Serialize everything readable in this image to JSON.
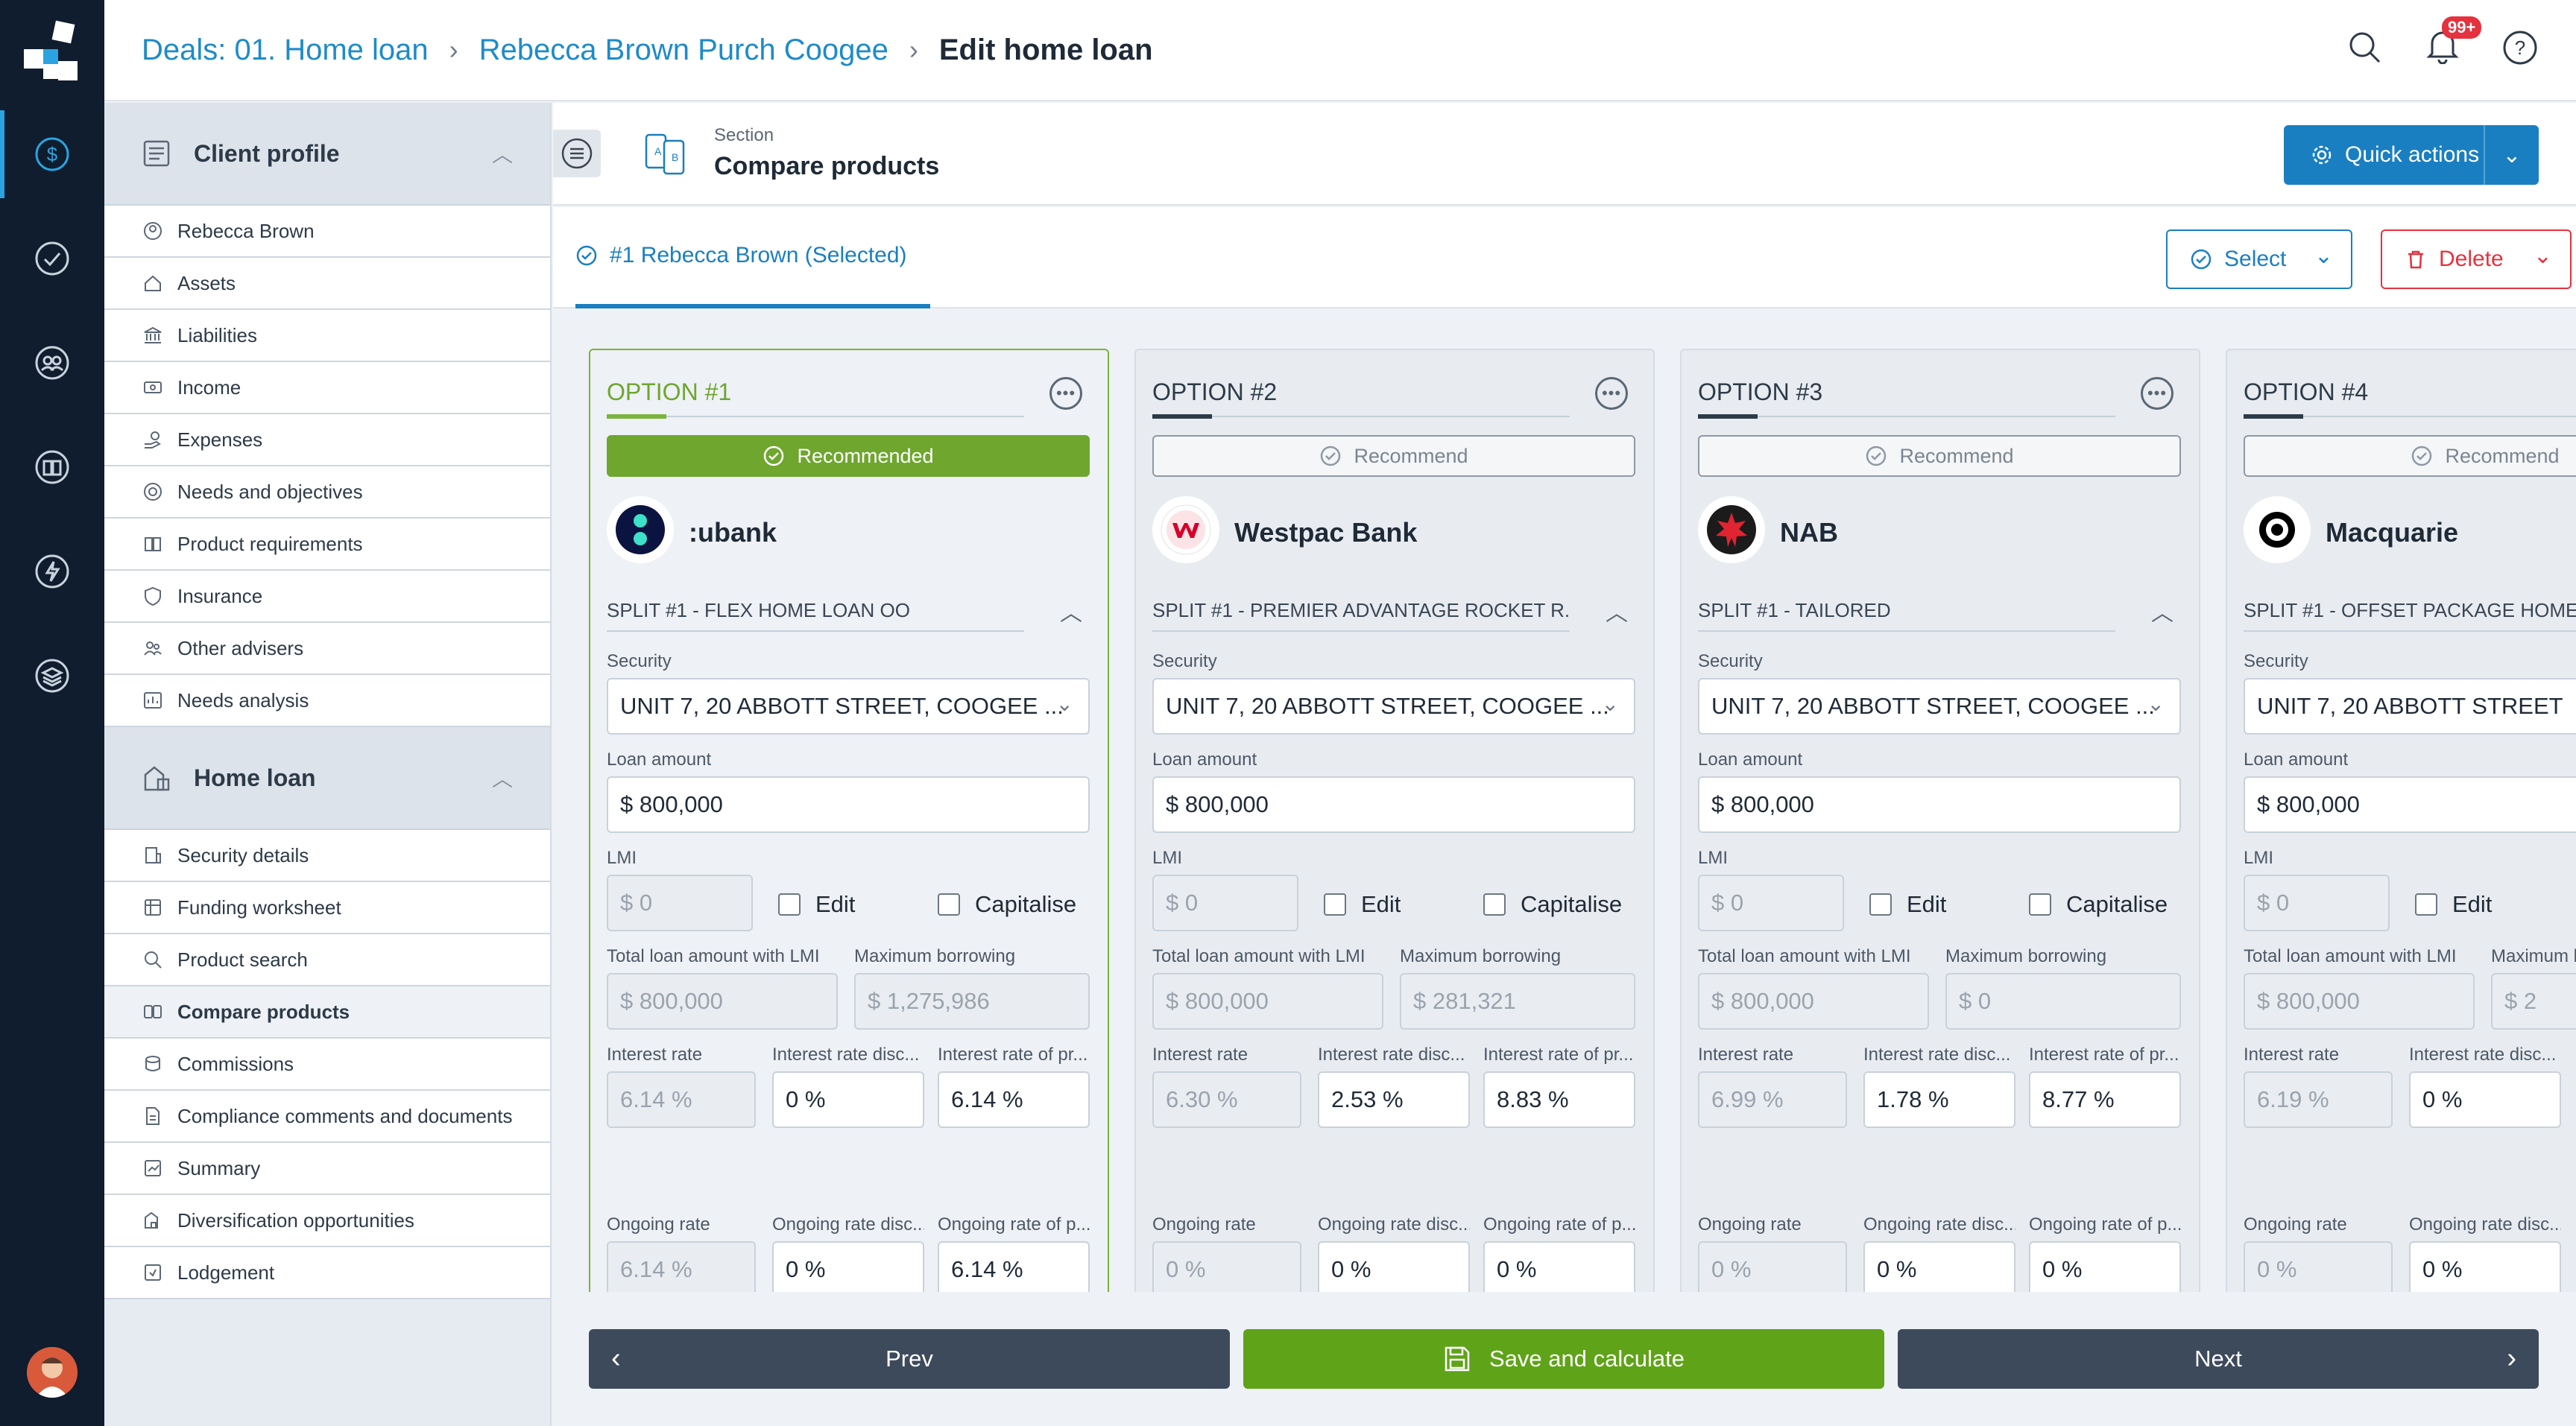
{
  "breadcrumb": {
    "crumb1": "Deals: 01. Home loan",
    "crumb2": "Rebecca Brown Purch Coogee",
    "current": "Edit home loan"
  },
  "notifications": {
    "badge": "99+"
  },
  "sidebar": {
    "client_profile": {
      "title": "Client profile",
      "items": [
        "Rebecca Brown",
        "Assets",
        "Liabilities",
        "Income",
        "Expenses",
        "Needs and objectives",
        "Product requirements",
        "Insurance",
        "Other advisers",
        "Needs analysis"
      ]
    },
    "home_loan": {
      "title": "Home loan",
      "items": [
        "Security details",
        "Funding worksheet",
        "Product search",
        "Compare products",
        "Commissions",
        "Compliance comments and documents",
        "Summary",
        "Diversification opportunities",
        "Lodgement"
      ]
    }
  },
  "section": {
    "small": "Section",
    "title": "Compare products",
    "quick_actions": "Quick actions"
  },
  "tabbar": {
    "tab": "#1 Rebecca Brown (Selected)",
    "select": "Select",
    "delete": "Delete"
  },
  "labels": {
    "security": "Security",
    "loan_amount": "Loan amount",
    "lmi": "LMI",
    "edit": "Edit",
    "capitalise": "Capitalise",
    "total_loan": "Total loan amount with LMI",
    "max_borrowing": "Maximum borrowing",
    "interest_rate": "Interest rate",
    "interest_disc": "Interest rate disc...",
    "interest_prod": "Interest rate of pr...",
    "ongoing_rate": "Ongoing rate",
    "ongoing_disc": "Ongoing rate disc...",
    "ongoing_prod": "Ongoing rate of p..."
  },
  "options": [
    {
      "title": "OPTION #1",
      "recommend": "Recommended",
      "bank": ":ubank",
      "split": "SPLIT #1 - FLEX HOME LOAN OO",
      "security": "UNIT 7, 20 ABBOTT STREET, COOGEE ...",
      "loan_amount": "$ 800,000",
      "lmi": "$ 0",
      "total_loan": "$ 800,000",
      "max_borrowing": "$ 1,275,986",
      "interest_rate": "6.14 %",
      "interest_disc": "0 %",
      "interest_prod": "6.14 %",
      "ongoing_rate": "6.14 %",
      "ongoing_disc": "0 %",
      "ongoing_prod": "6.14 %"
    },
    {
      "title": "OPTION #2",
      "recommend": "Recommend",
      "bank": "Westpac Bank",
      "split": "SPLIT #1 - PREMIER ADVANTAGE ROCKET R...",
      "security": "UNIT 7, 20 ABBOTT STREET, COOGEE ...",
      "loan_amount": "$ 800,000",
      "lmi": "$ 0",
      "total_loan": "$ 800,000",
      "max_borrowing": "$ 281,321",
      "interest_rate": "6.30 %",
      "interest_disc": "2.53 %",
      "interest_prod": "8.83 %",
      "ongoing_rate": "0 %",
      "ongoing_disc": "0 %",
      "ongoing_prod": "0 %"
    },
    {
      "title": "OPTION #3",
      "recommend": "Recommend",
      "bank": "NAB",
      "split": "SPLIT #1 - TAILORED",
      "security": "UNIT 7, 20 ABBOTT STREET, COOGEE ...",
      "loan_amount": "$ 800,000",
      "lmi": "$ 0",
      "total_loan": "$ 800,000",
      "max_borrowing": "$ 0",
      "interest_rate": "6.99 %",
      "interest_disc": "1.78 %",
      "interest_prod": "8.77 %",
      "ongoing_rate": "0 %",
      "ongoing_disc": "0 %",
      "ongoing_prod": "0 %"
    },
    {
      "title": "OPTION #4",
      "recommend": "Recommend",
      "bank": "Macquarie",
      "split": "SPLIT #1 - OFFSET PACKAGE HOME",
      "security": "UNIT 7, 20 ABBOTT STREET",
      "loan_amount": "$ 800,000",
      "lmi": "$ 0",
      "total_loan": "$ 800,000",
      "max_borrowing": "$ 2",
      "interest_rate": "6.19 %",
      "interest_disc": "0 %",
      "interest_prod": "",
      "ongoing_rate": "0 %",
      "ongoing_disc": "0 %",
      "ongoing_prod": ""
    }
  ],
  "bottom": {
    "prev": "Prev",
    "save": "Save and calculate",
    "next": "Next"
  },
  "colors": {
    "accent": "#1a7fc1",
    "recommend_green": "#6ea62e",
    "delete_red": "#e5323e",
    "rail": "#0f1d2e"
  }
}
